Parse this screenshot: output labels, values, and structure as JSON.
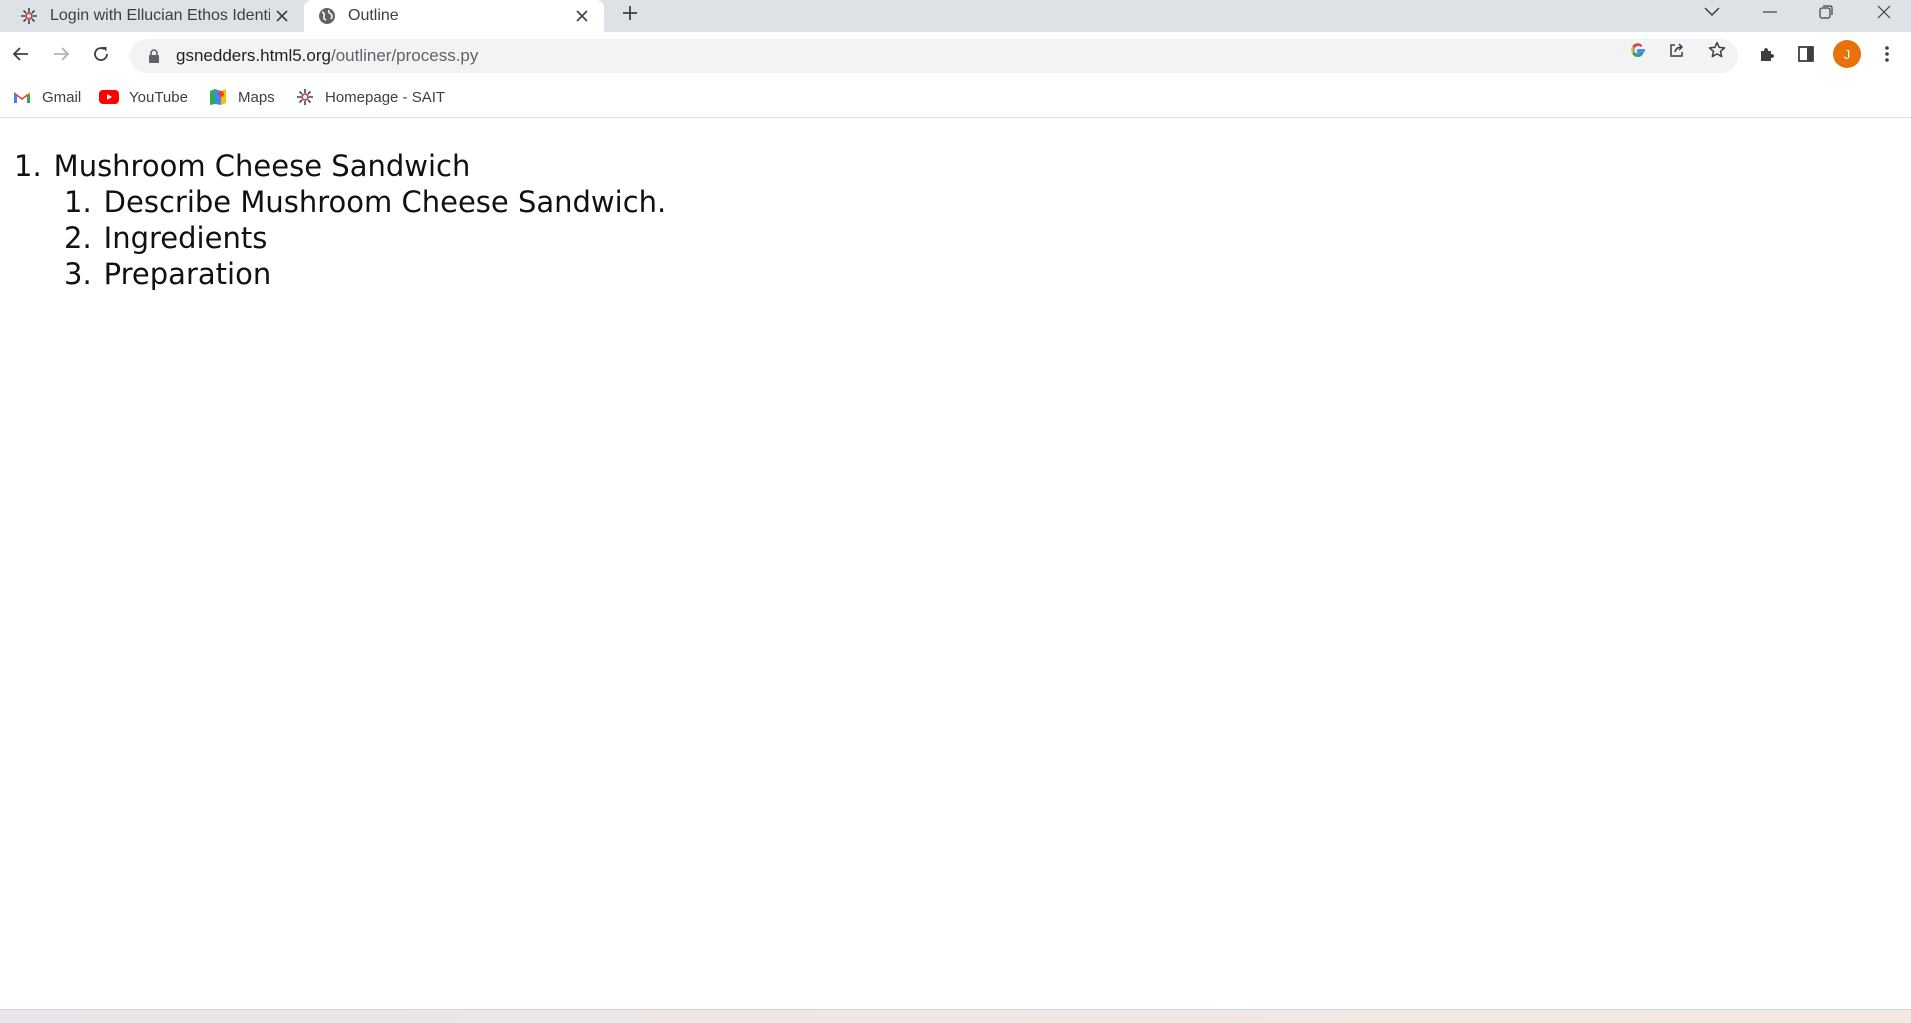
{
  "browser": {
    "tabs": [
      {
        "title": "Login with Ellucian Ethos Identity",
        "active": false,
        "favicon": "ellucian-logo-icon"
      },
      {
        "title": "Outline",
        "active": true,
        "favicon": "globe-icon"
      }
    ],
    "address_bar": {
      "domain": "gsnedders.html5.org",
      "path": "/outliner/process.py"
    },
    "profile_initial": "J",
    "profile_color": "#e8710a",
    "bookmarks": [
      {
        "label": "Gmail",
        "icon": "gmail-icon"
      },
      {
        "label": "YouTube",
        "icon": "youtube-icon"
      },
      {
        "label": "Maps",
        "icon": "maps-icon"
      },
      {
        "label": "Homepage - SAIT",
        "icon": "ellucian-logo-icon"
      }
    ]
  },
  "outline": {
    "root": {
      "number": "1.",
      "title": "Mushroom Cheese Sandwich"
    },
    "children": [
      {
        "number": "1.",
        "title": "Describe Mushroom Cheese Sandwich."
      },
      {
        "number": "2.",
        "title": "Ingredients"
      },
      {
        "number": "3.",
        "title": "Preparation"
      }
    ]
  }
}
